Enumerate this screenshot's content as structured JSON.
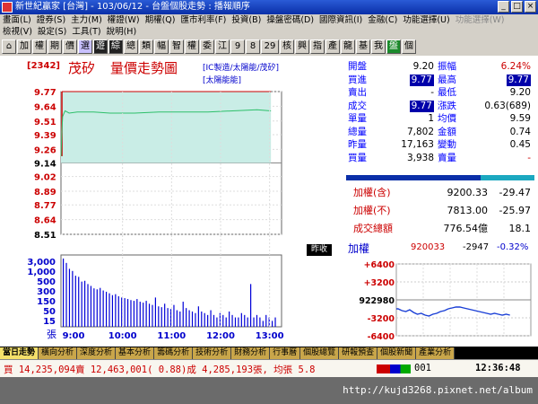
{
  "window": {
    "title": "新世紀贏家 [台灣] - 103/06/12 - 台盤個股走勢 : 播報順序",
    "min": "_",
    "max": "□",
    "close": "×"
  },
  "menu1": [
    "畫面(L)",
    "證券(S)",
    "主力(M)",
    "權證(W)",
    "期權(Q)",
    "匯市利率(F)",
    "投資(B)",
    "操盤密碼(D)",
    "國際資訊(I)",
    "金融(C)",
    "功能選擇(U)",
    "功能選擇(W)"
  ],
  "menu2": [
    "檢視(V)",
    "設定(S)",
    "工具(T)",
    "說明(H)"
  ],
  "toolbar": [
    "加",
    "權",
    "期",
    "價",
    "選",
    "遊",
    "綜",
    "總",
    "類",
    "幅",
    "智",
    "權",
    "委",
    "江",
    "9",
    "8",
    "29",
    "核",
    "興",
    "指",
    "產",
    "龍",
    "基",
    "我",
    "盤",
    "個"
  ],
  "chart": {
    "stock_code": "[2342]",
    "stock_name": "茂矽",
    "chart_tag": "量價走勢圖",
    "sub1": "[IC製造/太陽能/茂矽]",
    "sub2": "[太陽能能]",
    "yesterday_label": "昨收",
    "colors": {
      "line": "#2dbf6a",
      "fill": "#c9ede6",
      "open": "#c00",
      "vol": "#0000d8"
    }
  },
  "chart_data": {
    "type": "line",
    "price": {
      "y_ticks": [
        "9.77",
        "9.64",
        "9.51",
        "9.39",
        "9.26",
        "9.14",
        "9.02",
        "8.89",
        "8.77",
        "8.64",
        "8.51"
      ],
      "ylim": [
        8.51,
        9.77
      ],
      "reference": 9.14,
      "series": [
        {
          "x": [
            0,
            1,
            2,
            5,
            10,
            20,
            40,
            60,
            90,
            120,
            150,
            180,
            210,
            240,
            257
          ],
          "y": [
            9.2,
            9.4,
            9.55,
            9.6,
            9.58,
            9.59,
            9.59,
            9.58,
            9.58,
            9.59,
            9.59,
            9.59,
            9.6,
            9.61,
            9.6
          ]
        }
      ],
      "open_x": 0
    },
    "volume": {
      "y_ticks": [
        "3,000",
        "1,000",
        "500",
        "300",
        "150",
        "50",
        "15"
      ],
      "unit": "張",
      "bars": [
        3000,
        1800,
        900,
        700,
        400,
        350,
        200,
        220,
        150,
        120,
        90,
        80,
        95,
        70,
        60,
        50,
        40,
        45,
        35,
        30,
        28,
        25,
        22,
        20,
        25,
        18,
        16,
        20,
        14,
        12,
        30,
        10,
        9,
        14,
        8,
        7,
        12,
        6,
        5,
        18,
        8,
        6,
        5,
        4,
        10,
        5,
        4,
        3,
        6,
        3,
        2,
        4,
        3,
        2,
        5,
        3,
        2,
        2,
        4,
        3,
        2,
        150,
        2,
        3,
        2,
        1,
        3,
        2,
        1,
        2
      ]
    },
    "x_ticks": [
      "9:00",
      "10:00",
      "11:00",
      "12:00",
      "13:00"
    ],
    "grid": true
  },
  "quote": {
    "rows": [
      {
        "l1": "開盤",
        "v1": "9.20",
        "c1": "#000",
        "l2": "振幅",
        "v2": "6.24%",
        "c2": "#c00"
      },
      {
        "l1": "買進",
        "v1": "9.77",
        "c1": "box",
        "l2": "最高",
        "v2": "9.77",
        "c2": "box"
      },
      {
        "l1": "賣出",
        "v1": "-",
        "c1": "#000",
        "l2": "最低",
        "v2": "9.20",
        "c2": "#000"
      },
      {
        "l1": "成交",
        "v1": "9.77",
        "c1": "box",
        "l2": "漲跌",
        "v2": "0.63(689)",
        "c2": "#000"
      },
      {
        "l1": "單量",
        "v1": "1",
        "c1": "#000",
        "l2": "均價",
        "v2": "9.59",
        "c2": "#000"
      },
      {
        "l1": "總量",
        "v1": "7,802",
        "c1": "#000",
        "l2": "金額",
        "v2": "0.74",
        "c2": "#000"
      },
      {
        "l1": "昨量",
        "v1": "17,163",
        "c1": "#000",
        "l2": "變動",
        "v2": "0.45",
        "c2": "#000"
      },
      {
        "l1": "買量",
        "v1": "3,938",
        "c1": "#000",
        "l2": "賣量",
        "v2": "-",
        "c2": "#c00"
      }
    ]
  },
  "index": {
    "rows": [
      {
        "label": "加權(含)",
        "value": "9200.33",
        "change": "-29.47"
      },
      {
        "label": "加權(不)",
        "value": "7813.00",
        "change": "-25.97"
      },
      {
        "label": "成交總額",
        "value": "776.54億",
        "change": "18.1"
      }
    ]
  },
  "mini": {
    "title": "加權",
    "value": "920033",
    "change": "-2947",
    "pct": "-0.32%",
    "y_ticks": [
      "+6400",
      "+3200",
      "922980",
      "-3200",
      "-6400"
    ]
  },
  "tabs": [
    "當日走勢",
    "橫向分析",
    "深度分析",
    "基本分析",
    "籌碼分析",
    "技術分析",
    "財務分析",
    "行事曆",
    "個股總覽",
    "研報預查",
    "個股新聞",
    "產業分析"
  ],
  "status": {
    "text": "買 14,235,094賣 12,463,001( 0.88)成 4,285,193張, 均張 5.8",
    "code": "001",
    "time": "12:36:48"
  },
  "footer": {
    "text": "http://kujd3268.pixnet.net/album"
  }
}
